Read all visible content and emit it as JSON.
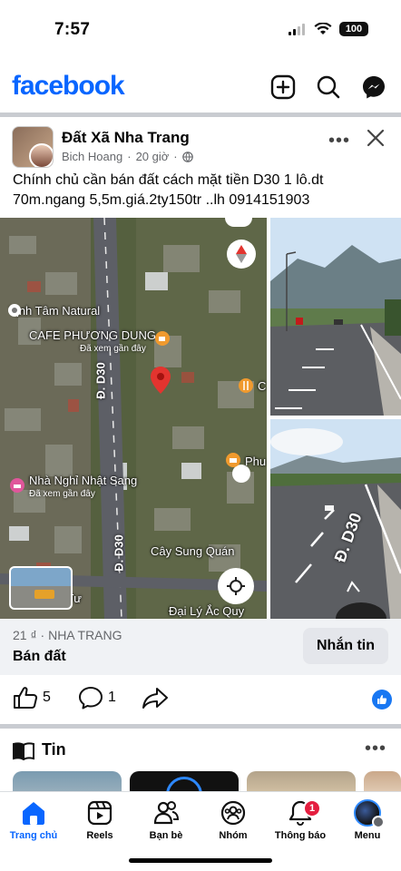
{
  "status": {
    "time": "7:57",
    "battery": "100"
  },
  "header": {
    "logo": "facebook",
    "icons": [
      "plus-square-icon",
      "search-icon",
      "messenger-icon"
    ]
  },
  "post": {
    "group_name": "Đất Xã Nha Trang",
    "author": "Bich Hoang",
    "time": "20 giờ",
    "text": "Chính chủ cần bán đất cách mặt tiền D30 1 lô.dt 70m.ngang 5,5m.giá.2ty150tr ..lh 0914151903",
    "map": {
      "labels": {
        "tinh_tam": "Tịnh Tâm Natural",
        "cafe": "CAFE PHƯƠNG DUNG",
        "cafe_sub": "Đã xem gần đây",
        "nha_nghi": "Nhà Nghỉ Nhật Sang",
        "nha_nghi_sub": "Đã xem gần đây",
        "cay_sung": "Cây Sung Quán",
        "dai_ly": "Đại Lý Ắc Quy",
        "a_tu": "A Tư",
        "phu": "Phu",
        "road_top": "Đ. D30",
        "road_bottom": "Đ. D30",
        "road_photo": "Đ. D30"
      }
    },
    "market": {
      "price_location": "21 ₫ · NHA TRANG",
      "title": "Bán đất",
      "message_button": "Nhắn tin"
    },
    "actions": {
      "likes": "5",
      "comments": "1"
    }
  },
  "stories": {
    "title": "Tin"
  },
  "nav": {
    "items": [
      {
        "label": "Trang chủ",
        "icon": "home-icon",
        "active": true
      },
      {
        "label": "Reels",
        "icon": "reels-icon"
      },
      {
        "label": "Bạn bè",
        "icon": "friends-icon"
      },
      {
        "label": "Nhóm",
        "icon": "groups-icon"
      },
      {
        "label": "Thông báo",
        "icon": "bell-icon",
        "badge": "1"
      },
      {
        "label": "Menu",
        "icon": "menu-avatar-icon"
      }
    ]
  },
  "colors": {
    "brand": "#0866ff",
    "badge": "#e41e3f",
    "like": "#1877f2"
  }
}
